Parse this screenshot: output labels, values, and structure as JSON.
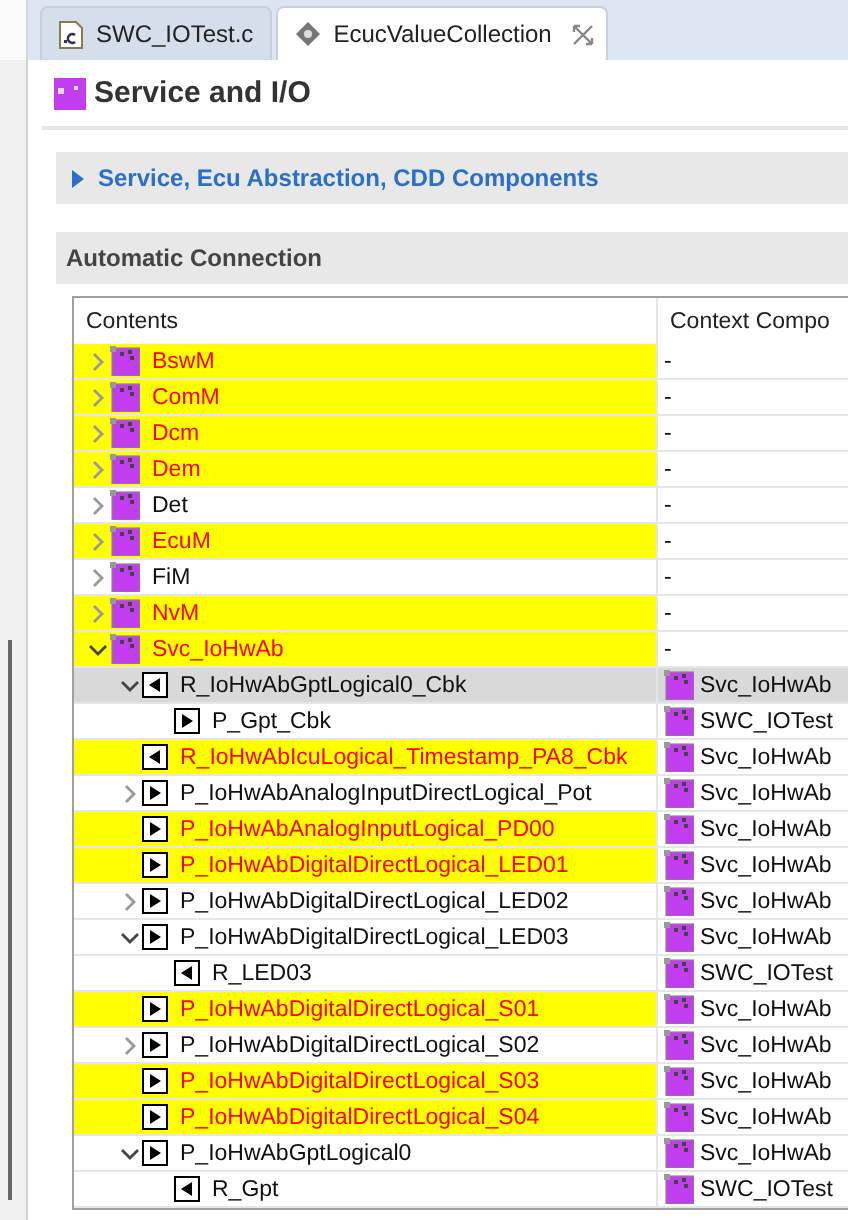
{
  "tabs": [
    {
      "label": "SWC_IOTest.c",
      "kind": "c-file",
      "selected": false
    },
    {
      "label": "EcucValueCollection",
      "kind": "ecuc",
      "selected": true
    }
  ],
  "editor": {
    "title": "Service and I/O",
    "sections": [
      {
        "label": "Service, Ecu Abstraction, CDD Components",
        "kind": "collapsible",
        "expanded": false
      },
      {
        "label": "Automatic Connection",
        "kind": "heading"
      }
    ]
  },
  "tree": {
    "columns": [
      "Contents",
      "Context Compo"
    ],
    "rows": [
      {
        "label": "BswM",
        "kind": "module",
        "highlighted": true,
        "selected": false,
        "expanded": false,
        "context": "-",
        "context_icon": false
      },
      {
        "label": "ComM",
        "kind": "module",
        "highlighted": true,
        "selected": false,
        "expanded": false,
        "context": "-",
        "context_icon": false
      },
      {
        "label": "Dcm",
        "kind": "module",
        "highlighted": true,
        "selected": false,
        "expanded": false,
        "context": "-",
        "context_icon": false
      },
      {
        "label": "Dem",
        "kind": "module",
        "highlighted": true,
        "selected": false,
        "expanded": false,
        "context": "-",
        "context_icon": false
      },
      {
        "label": "Det",
        "kind": "module",
        "highlighted": false,
        "selected": false,
        "expanded": false,
        "context": "-",
        "context_icon": false
      },
      {
        "label": "EcuM",
        "kind": "module",
        "highlighted": true,
        "selected": false,
        "expanded": false,
        "context": "-",
        "context_icon": false
      },
      {
        "label": "FiM",
        "kind": "module",
        "highlighted": false,
        "selected": false,
        "expanded": false,
        "context": "-",
        "context_icon": false
      },
      {
        "label": "NvM",
        "kind": "module",
        "highlighted": true,
        "selected": false,
        "expanded": false,
        "context": "-",
        "context_icon": false
      },
      {
        "label": "Svc_IoHwAb",
        "kind": "module",
        "highlighted": true,
        "selected": false,
        "expanded": true,
        "context": "-",
        "context_icon": false,
        "children": [
          {
            "label": "R_IoHwAbGptLogical0_Cbk",
            "kind": "required-port",
            "highlighted": false,
            "selected": true,
            "expanded": true,
            "context": "Svc_IoHwAb",
            "context_icon": true,
            "children": [
              {
                "label": "P_Gpt_Cbk",
                "kind": "provided-port",
                "highlighted": false,
                "selected": false,
                "context": "SWC_IOTest",
                "context_icon": true
              }
            ]
          },
          {
            "label": "R_IoHwAbIcuLogical_Timestamp_PA8_Cbk",
            "kind": "required-port",
            "highlighted": true,
            "selected": false,
            "context": "Svc_IoHwAb",
            "context_icon": true
          },
          {
            "label": "P_IoHwAbAnalogInputDirectLogical_Pot",
            "kind": "provided-port",
            "highlighted": false,
            "selected": false,
            "expanded": false,
            "context": "Svc_IoHwAb",
            "context_icon": true
          },
          {
            "label": "P_IoHwAbAnalogInputLogical_PD00",
            "kind": "provided-port",
            "highlighted": true,
            "selected": false,
            "context": "Svc_IoHwAb",
            "context_icon": true
          },
          {
            "label": "P_IoHwAbDigitalDirectLogical_LED01",
            "kind": "provided-port",
            "highlighted": true,
            "selected": false,
            "context": "Svc_IoHwAb",
            "context_icon": true
          },
          {
            "label": "P_IoHwAbDigitalDirectLogical_LED02",
            "kind": "provided-port",
            "highlighted": false,
            "selected": false,
            "expanded": false,
            "context": "Svc_IoHwAb",
            "context_icon": true
          },
          {
            "label": "P_IoHwAbDigitalDirectLogical_LED03",
            "kind": "provided-port",
            "highlighted": false,
            "selected": false,
            "expanded": true,
            "context": "Svc_IoHwAb",
            "context_icon": true,
            "children": [
              {
                "label": "R_LED03",
                "kind": "required-port",
                "highlighted": false,
                "selected": false,
                "context": "SWC_IOTest",
                "context_icon": true
              }
            ]
          },
          {
            "label": "P_IoHwAbDigitalDirectLogical_S01",
            "kind": "provided-port",
            "highlighted": true,
            "selected": false,
            "context": "Svc_IoHwAb",
            "context_icon": true
          },
          {
            "label": "P_IoHwAbDigitalDirectLogical_S02",
            "kind": "provided-port",
            "highlighted": false,
            "selected": false,
            "expanded": false,
            "context": "Svc_IoHwAb",
            "context_icon": true
          },
          {
            "label": "P_IoHwAbDigitalDirectLogical_S03",
            "kind": "provided-port",
            "highlighted": true,
            "selected": false,
            "context": "Svc_IoHwAb",
            "context_icon": true
          },
          {
            "label": "P_IoHwAbDigitalDirectLogical_S04",
            "kind": "provided-port",
            "highlighted": true,
            "selected": false,
            "context": "Svc_IoHwAb",
            "context_icon": true
          },
          {
            "label": "P_IoHwAbGptLogical0",
            "kind": "provided-port",
            "highlighted": false,
            "selected": false,
            "expanded": true,
            "context": "Svc_IoHwAb",
            "context_icon": true,
            "children": [
              {
                "label": "R_Gpt",
                "kind": "required-port",
                "highlighted": false,
                "selected": false,
                "context": "SWC_IOTest",
                "context_icon": true
              }
            ]
          }
        ]
      }
    ]
  }
}
